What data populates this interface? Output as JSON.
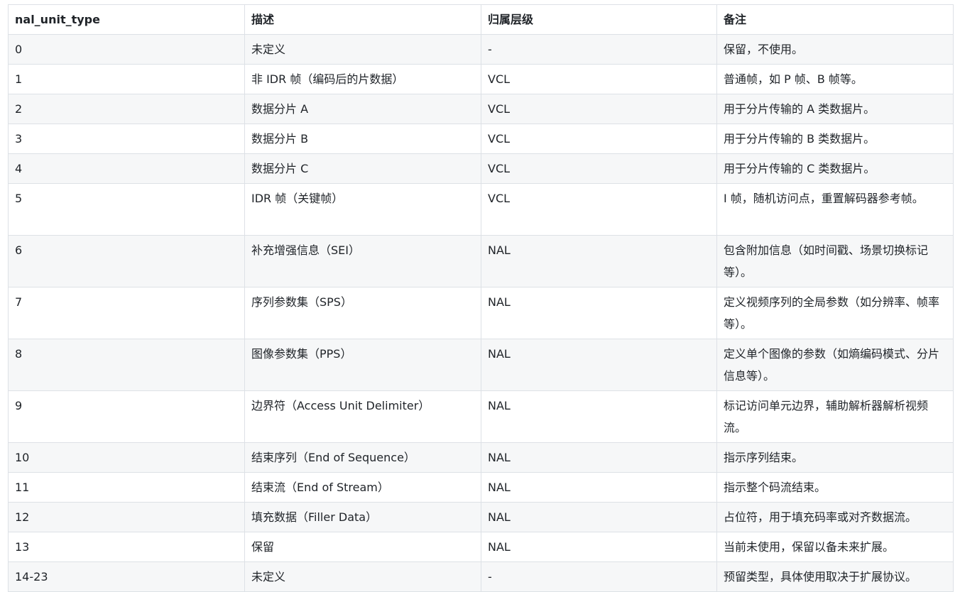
{
  "table": {
    "headers": [
      "nal_unit_type",
      "描述",
      "归属层级",
      "备注"
    ],
    "rows": [
      {
        "type": "0",
        "desc": "未定义",
        "layer": "-",
        "note": "保留，不使用。"
      },
      {
        "type": "1",
        "desc": "非 IDR 帧（编码后的片数据）",
        "layer": "VCL",
        "note": "普通帧，如 P 帧、B 帧等。"
      },
      {
        "type": "2",
        "desc": "数据分片 A",
        "layer": "VCL",
        "note": "用于分片传输的 A 类数据片。"
      },
      {
        "type": "3",
        "desc": "数据分片 B",
        "layer": "VCL",
        "note": "用于分片传输的 B 类数据片。"
      },
      {
        "type": "4",
        "desc": "数据分片 C",
        "layer": "VCL",
        "note": "用于分片传输的 C 类数据片。"
      },
      {
        "type": "5",
        "desc": "IDR 帧（关键帧）",
        "layer": "VCL",
        "note": "I 帧，随机访问点，重置解码器参考帧。"
      },
      {
        "type": "6",
        "desc": "补充增强信息（SEI）",
        "layer": "NAL",
        "note": "包含附加信息（如时间戳、场景切换标记等）。"
      },
      {
        "type": "7",
        "desc": "序列参数集（SPS）",
        "layer": "NAL",
        "note": "定义视频序列的全局参数（如分辨率、帧率等）。"
      },
      {
        "type": "8",
        "desc": "图像参数集（PPS）",
        "layer": "NAL",
        "note": "定义单个图像的参数（如熵编码模式、分片信息等）。"
      },
      {
        "type": "9",
        "desc": "边界符（Access Unit Delimiter）",
        "layer": "NAL",
        "note": "标记访问单元边界，辅助解析器解析视频流。"
      },
      {
        "type": "10",
        "desc": "结束序列（End of Sequence）",
        "layer": "NAL",
        "note": "指示序列结束。"
      },
      {
        "type": "11",
        "desc": "结束流（End of Stream）",
        "layer": "NAL",
        "note": "指示整个码流结束。"
      },
      {
        "type": "12",
        "desc": "填充数据（Filler Data）",
        "layer": "NAL",
        "note": "占位符，用于填充码率或对齐数据流。"
      },
      {
        "type": "13",
        "desc": "保留",
        "layer": "NAL",
        "note": "当前未使用，保留以备未来扩展。"
      },
      {
        "type": "14-23",
        "desc": "未定义",
        "layer": "-",
        "note": "预留类型，具体使用取决于扩展协议。"
      }
    ]
  }
}
